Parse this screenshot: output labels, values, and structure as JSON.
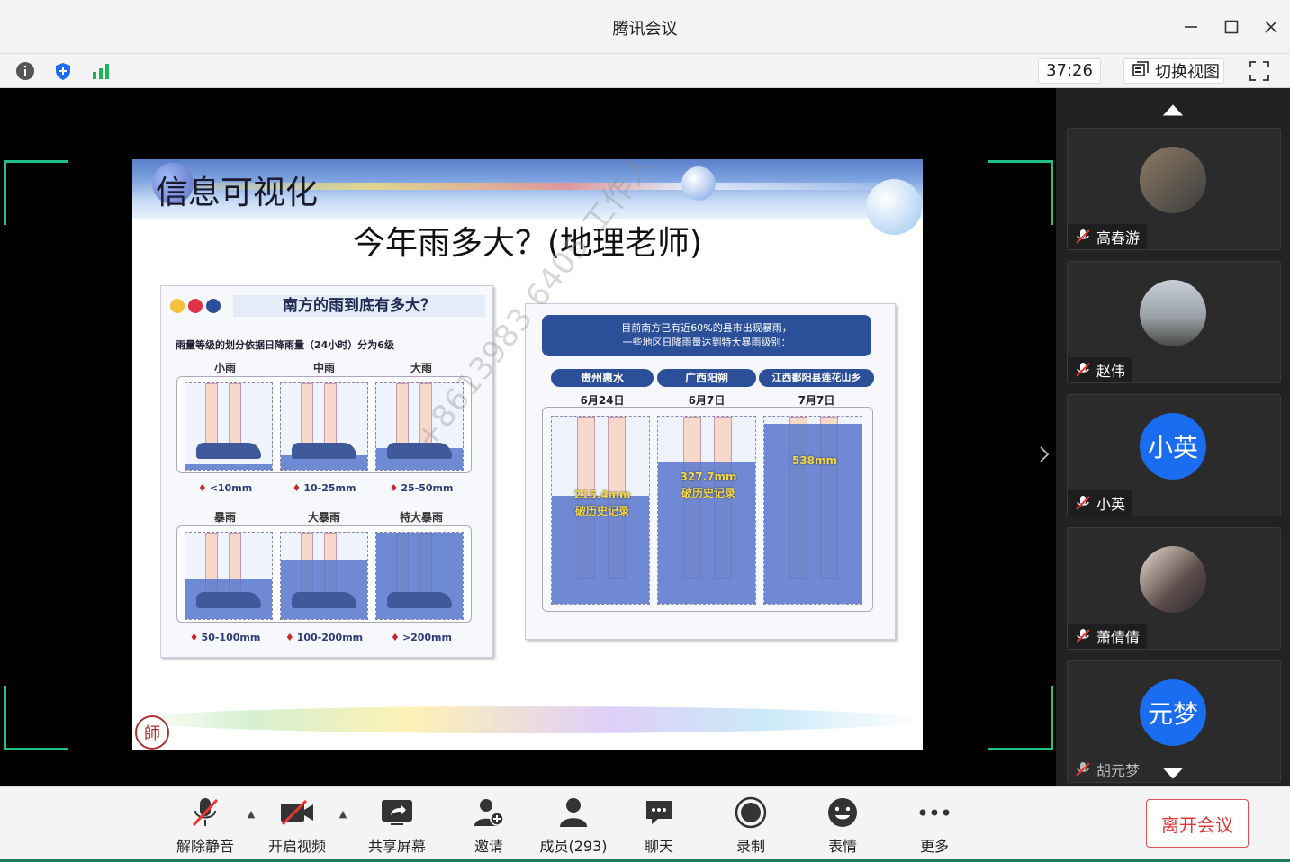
{
  "window": {
    "title": "腾讯会议"
  },
  "infobar": {
    "timer": "37:26",
    "switch_view": "切换视图"
  },
  "slide": {
    "heading": "信息可视化",
    "subtitle": "今年雨多大？(地理老师)",
    "watermark": "+8613983 6405 工作人员",
    "seal": "師",
    "card_left": {
      "title": "南方的雨到底有多大？",
      "desc": "雨量等级的划分依据日降雨量（24小时）分为6级",
      "levels_top": [
        {
          "label": "小雨",
          "range": "<10mm"
        },
        {
          "label": "中雨",
          "range": "10-25mm"
        },
        {
          "label": "大雨",
          "range": "25-50mm"
        }
      ],
      "levels_bottom": [
        {
          "label": "暴雨",
          "range": "50-100mm"
        },
        {
          "label": "大暴雨",
          "range": "100-200mm"
        },
        {
          "label": "特大暴雨",
          "range": ">200mm"
        }
      ]
    },
    "card_right": {
      "note_line1": "目前南方已有近60%的县市出现暴雨，",
      "note_line2": "一些地区日降雨量达到特大暴雨级别：",
      "places": [
        {
          "name": "贵州惠水",
          "date": "6月24日",
          "mm": "215.4mm",
          "note": "破历史记录"
        },
        {
          "name": "广西阳朔",
          "date": "6月7日",
          "mm": "327.7mm",
          "note": "破历史记录"
        },
        {
          "name": "江西鄱阳县莲花山乡",
          "date": "7月7日",
          "mm": "538mm",
          "note": ""
        }
      ]
    }
  },
  "participants": [
    {
      "name": "高春游",
      "avatar": "photo"
    },
    {
      "name": "赵伟",
      "avatar": "photo"
    },
    {
      "name": "小英",
      "avatar": "小英"
    },
    {
      "name": "萧倩倩",
      "avatar": "photo"
    },
    {
      "name": "胡元梦",
      "avatar": "元梦"
    }
  ],
  "toolbar": {
    "unmute": "解除静音",
    "start_video": "开启视频",
    "share_screen": "共享屏幕",
    "invite": "邀请",
    "members": "成员(293)",
    "chat": "聊天",
    "record": "录制",
    "reactions": "表情",
    "more": "更多",
    "leave": "离开会议"
  },
  "colors": {
    "accent_green": "#1fc08c",
    "avatar_blue": "#1a6cf0",
    "leave_red": "#e03838"
  }
}
